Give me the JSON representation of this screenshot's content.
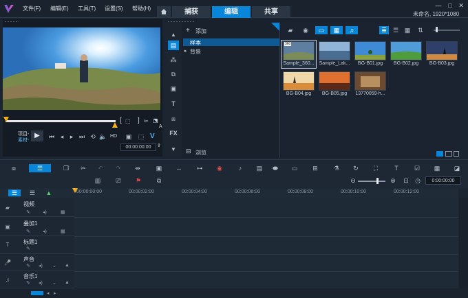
{
  "window": {
    "title_info": "未命名, 1920*1080",
    "btn_min": "—",
    "btn_max": "□",
    "btn_close": "✕"
  },
  "menu": [
    "文件(F)",
    "编辑(E)",
    "工具(T)",
    "设置(S)",
    "帮助(H)"
  ],
  "tabs": {
    "home_icon": "home-icon",
    "capture": "捕获",
    "edit": "编辑",
    "share": "共享"
  },
  "colors": {
    "accent": "#0a86d8",
    "playhead": "#f0b020",
    "panel": "#1b2532"
  },
  "player": {
    "project_label": "项目-",
    "clip_label": "素材-",
    "timecode": "00:00:00:00",
    "hd_badge": "HD",
    "brace_left": "[",
    "brace_right": "]",
    "a_label": "A"
  },
  "library": {
    "add_label": "添加",
    "folders": [
      "样本",
      "背景"
    ],
    "browse_label": "浏览",
    "fx_label": "FX",
    "t_label": "T"
  },
  "thumbs": [
    {
      "name": "Sample_360...",
      "color": "#5f7fa0",
      "badge": "360"
    },
    {
      "name": "Sample_Lak...",
      "color": "#6a90b8",
      "badge": ""
    },
    {
      "name": "BG-B01.jpg",
      "color": "#3e8ad6",
      "badge": ""
    },
    {
      "name": "BG-B02.jpg",
      "color": "#4f9c3c",
      "badge": ""
    },
    {
      "name": "BG-B03.jpg",
      "color": "#2e3f6a",
      "badge": ""
    },
    {
      "name": "BG-B04.jpg",
      "color": "#d98c3a",
      "badge": ""
    },
    {
      "name": "BG-B05.jpg",
      "color": "#e07030",
      "badge": ""
    },
    {
      "name": "13770059-h...",
      "color": "#b89060",
      "badge": ""
    }
  ],
  "timeline": {
    "timecode": "0:00:00:00",
    "ruler": [
      "00:00:00:00",
      "00:00:02:00",
      "00:00:04:00",
      "00:00:06:00",
      "00:00:08:00",
      "00:00:10:00",
      "00:00:12:00"
    ],
    "tracks": [
      "视频",
      "叠加1",
      "标题1",
      "声音",
      "音乐1"
    ]
  }
}
